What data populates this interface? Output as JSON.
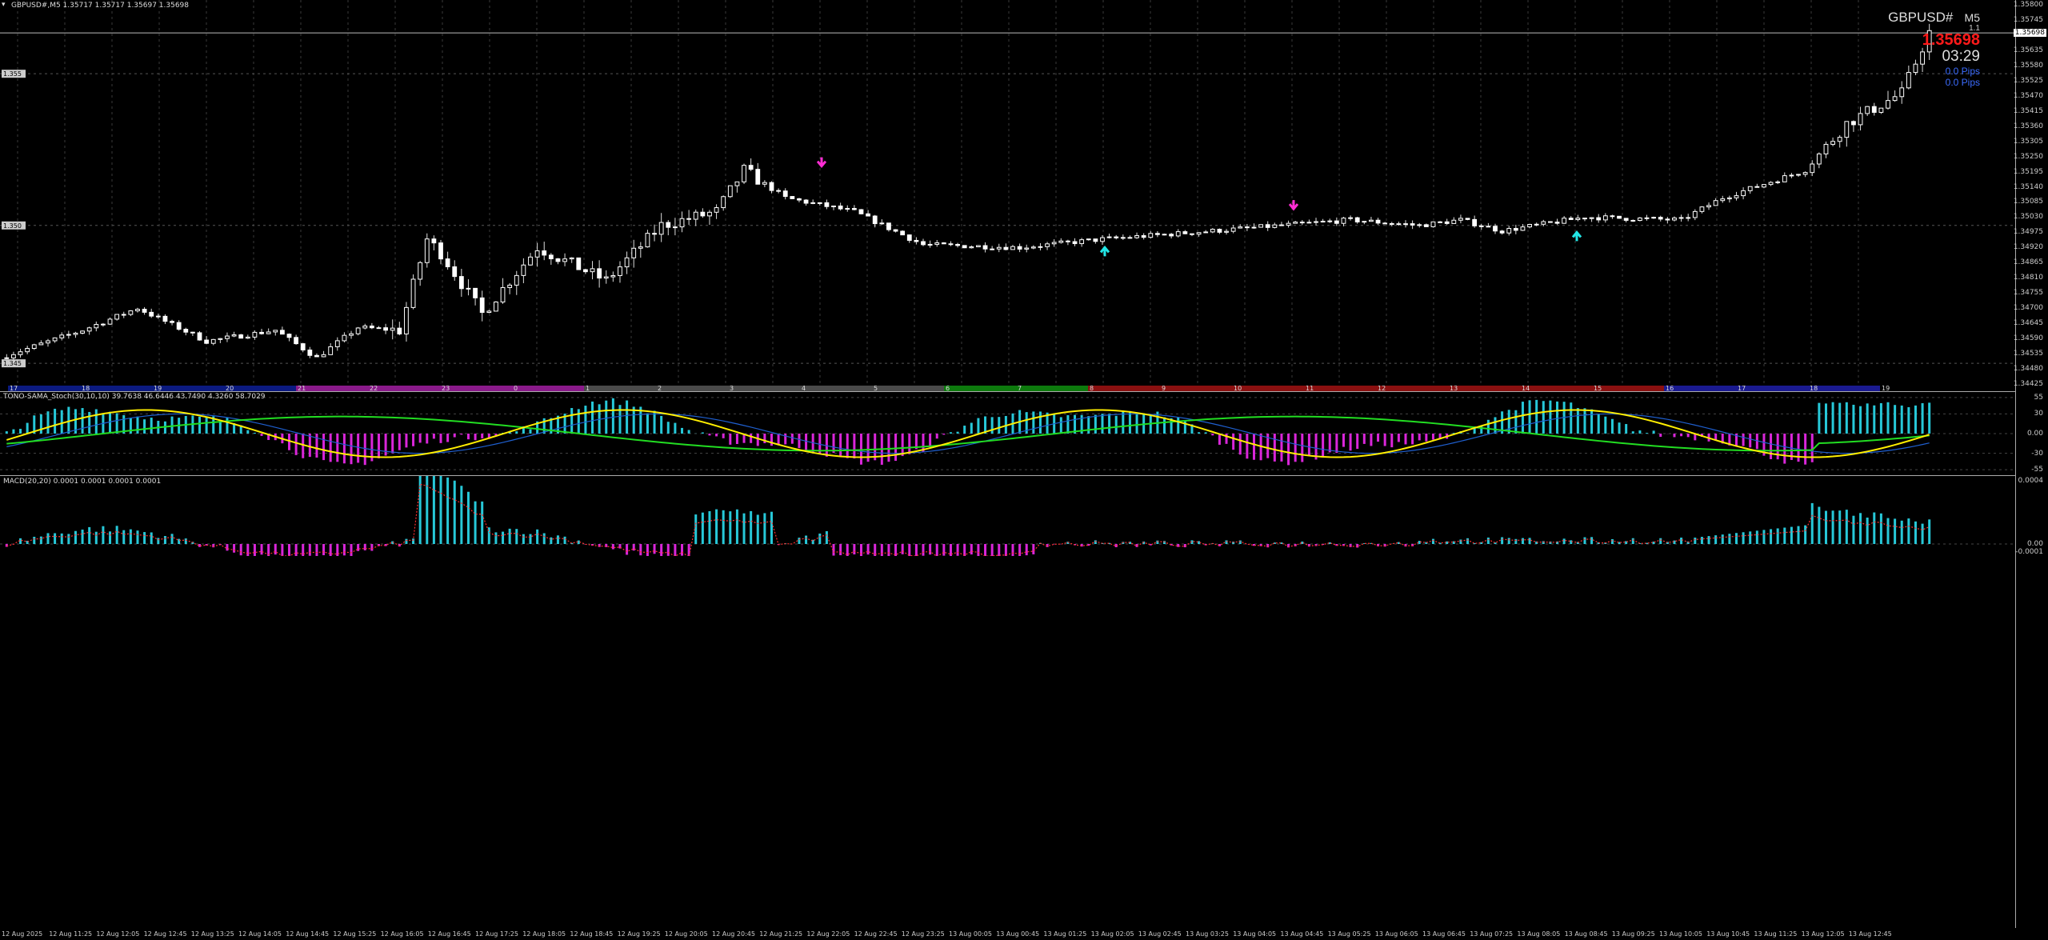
{
  "window": {
    "header": "GBPUSD#,M5  1.35717 1.35717 1.35697 1.35698"
  },
  "info_panel": {
    "symbol": "GBPUSD#",
    "timeframe": "M5",
    "spread": "1.1",
    "price": "1.35698",
    "countdown": "03:29",
    "pips_1": "0.0 Pips",
    "pips_2": "0.0 Pips",
    "price_color": "#ff1a1a",
    "pips_color": "#3b6cff"
  },
  "price_axis": [
    "1.35800",
    "1.35745",
    "1.35690",
    "1.35635",
    "1.35580",
    "1.35525",
    "1.35470",
    "1.35415",
    "1.35360",
    "1.35305",
    "1.35250",
    "1.35195",
    "1.35140",
    "1.35085",
    "1.35030",
    "1.34975",
    "1.34920",
    "1.34865",
    "1.34810",
    "1.34755",
    "1.34700",
    "1.34645",
    "1.34590",
    "1.34535",
    "1.34480",
    "1.34425"
  ],
  "current_price_tag": "1.35698",
  "level_tags": [
    "1.355",
    "1.350",
    "1.345"
  ],
  "session_bar": {
    "labels": [
      "17",
      "18",
      "19",
      "20",
      "21",
      "22",
      "23",
      "0",
      "1",
      "2",
      "3",
      "4",
      "5",
      "6",
      "7",
      "8",
      "9",
      "10",
      "11",
      "12",
      "13",
      "14",
      "15",
      "16",
      "17",
      "18",
      "19"
    ],
    "colors": {
      "asia": "#0b1a80",
      "magenta": "#8a1a8a",
      "grey": "#4a4a4a",
      "green": "#0d7a0d",
      "red": "#8a1010",
      "blue": "#1a1a90"
    }
  },
  "stoch_indicator": {
    "header": "TONO-SAMA_Stoch(30,10,10) 39.7638 46.6446 43.7490 4.3260 58.7029",
    "axis": [
      "55",
      "30",
      "0.00",
      "-30",
      "-55"
    ],
    "colors": {
      "pos": "#27c8d8",
      "neg": "#d926d9",
      "yellow": "#ffee00",
      "green": "#22dd22",
      "blue": "#1f5fcf"
    }
  },
  "macd_indicator": {
    "header": "MACD(20,20) 0.0001 0.0001 0.0001 0.0001",
    "axis": [
      "0.0004",
      "0.00",
      "-0.0001"
    ],
    "colors": {
      "pos": "#27c8d8",
      "neg": "#d926d9",
      "signal": "#ff3030"
    }
  },
  "time_axis": [
    "12 Aug 2025",
    "12 Aug 11:25",
    "12 Aug 12:05",
    "12 Aug 12:45",
    "12 Aug 13:25",
    "12 Aug 14:05",
    "12 Aug 14:45",
    "12 Aug 15:25",
    "12 Aug 16:05",
    "12 Aug 16:45",
    "12 Aug 17:25",
    "12 Aug 18:05",
    "12 Aug 18:45",
    "12 Aug 19:25",
    "12 Aug 20:05",
    "12 Aug 20:45",
    "12 Aug 21:25",
    "12 Aug 22:05",
    "12 Aug 22:45",
    "12 Aug 23:25",
    "13 Aug 00:05",
    "13 Aug 00:45",
    "13 Aug 01:25",
    "13 Aug 02:05",
    "13 Aug 02:45",
    "13 Aug 03:25",
    "13 Aug 04:05",
    "13 Aug 04:45",
    "13 Aug 05:25",
    "13 Aug 06:05",
    "13 Aug 06:45",
    "13 Aug 07:25",
    "13 Aug 08:05",
    "13 Aug 08:45",
    "13 Aug 09:25",
    "13 Aug 10:05",
    "13 Aug 10:45",
    "13 Aug 11:25",
    "13 Aug 12:05",
    "13 Aug 12:45"
  ],
  "signals": [
    {
      "type": "sell",
      "color": "#ff2dd4",
      "time": "12 Aug 22:05",
      "price": 1.35215
    },
    {
      "type": "buy",
      "color": "#22e6e6",
      "time": "13 Aug 02:05",
      "price": 1.3492
    },
    {
      "type": "sell",
      "color": "#ff2dd4",
      "time": "13 Aug 04:45",
      "price": 1.3506
    },
    {
      "type": "buy",
      "color": "#22e6e6",
      "time": "13 Aug 08:45",
      "price": 1.34975
    }
  ]
}
